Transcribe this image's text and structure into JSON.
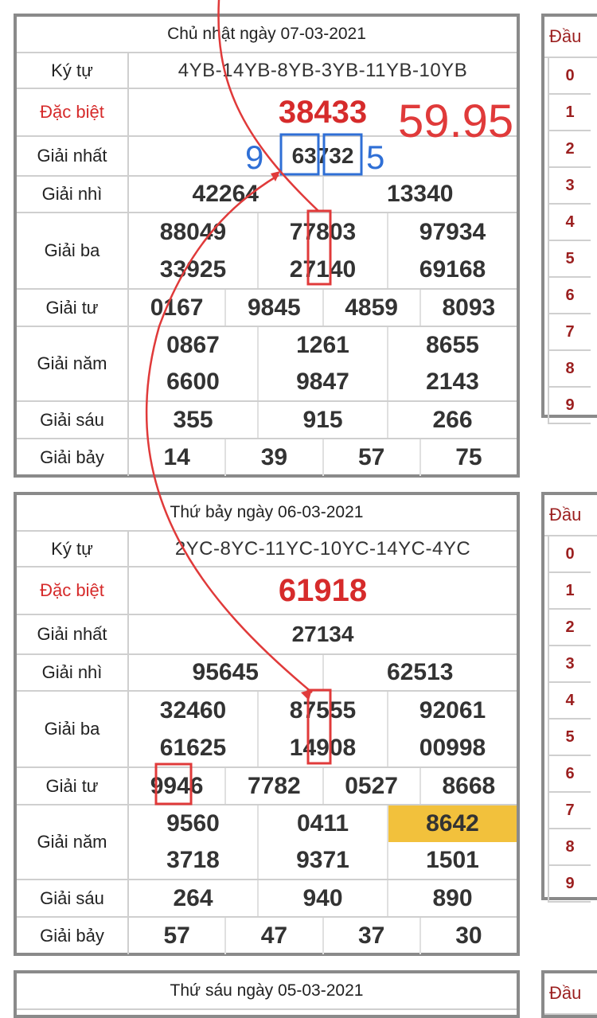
{
  "table1": {
    "header": "Chủ nhật ngày 07-03-2021",
    "kytu_label": "Ký tự",
    "kytu": "4YB-14YB-8YB-3YB-11YB-10YB",
    "special_label": "Đặc biệt",
    "special": "38433",
    "nhat_label": "Giải nhất",
    "nhat": "63732",
    "nhi_label": "Giải nhì",
    "nhi": [
      "42264",
      "13340"
    ],
    "ba_label": "Giải ba",
    "ba": [
      "88049",
      "77803",
      "97934",
      "33925",
      "27140",
      "69168"
    ],
    "tu_label": "Giải tư",
    "tu": [
      "0167",
      "9845",
      "4859",
      "8093"
    ],
    "nam_label": "Giải năm",
    "nam": [
      "0867",
      "1261",
      "8655",
      "6600",
      "9847",
      "2143"
    ],
    "sau_label": "Giải sáu",
    "sau": [
      "355",
      "915",
      "266"
    ],
    "bay_label": "Giải bảy",
    "bay": [
      "14",
      "39",
      "57",
      "75"
    ]
  },
  "table2": {
    "header": "Thứ bảy ngày 06-03-2021",
    "kytu_label": "Ký tự",
    "kytu": "2YC-8YC-11YC-10YC-14YC-4YC",
    "special_label": "Đặc biệt",
    "special": "61918",
    "nhat_label": "Giải nhất",
    "nhat": "27134",
    "nhi_label": "Giải nhì",
    "nhi": [
      "95645",
      "62513"
    ],
    "ba_label": "Giải ba",
    "ba": [
      "32460",
      "87555",
      "92061",
      "61625",
      "14908",
      "00998"
    ],
    "tu_label": "Giải tư",
    "tu": [
      "9946",
      "7782",
      "0527",
      "8668"
    ],
    "nam_label": "Giải năm",
    "nam": [
      "9560",
      "0411",
      "8642",
      "3718",
      "9371",
      "1501"
    ],
    "sau_label": "Giải sáu",
    "sau": [
      "264",
      "940",
      "890"
    ],
    "bay_label": "Giải bảy",
    "bay": [
      "57",
      "47",
      "37",
      "30"
    ]
  },
  "table3": {
    "header": "Thứ sáu ngày 05-03-2021"
  },
  "side": {
    "head": "Đầu",
    "digits": [
      "0",
      "1",
      "2",
      "3",
      "4",
      "5",
      "6",
      "7",
      "8",
      "9"
    ]
  },
  "annotations": {
    "big_number": "59.95",
    "left_digit": "9",
    "right_digit": "5",
    "red_color": "#e03a3a",
    "blue_color": "#2f6fd6"
  }
}
